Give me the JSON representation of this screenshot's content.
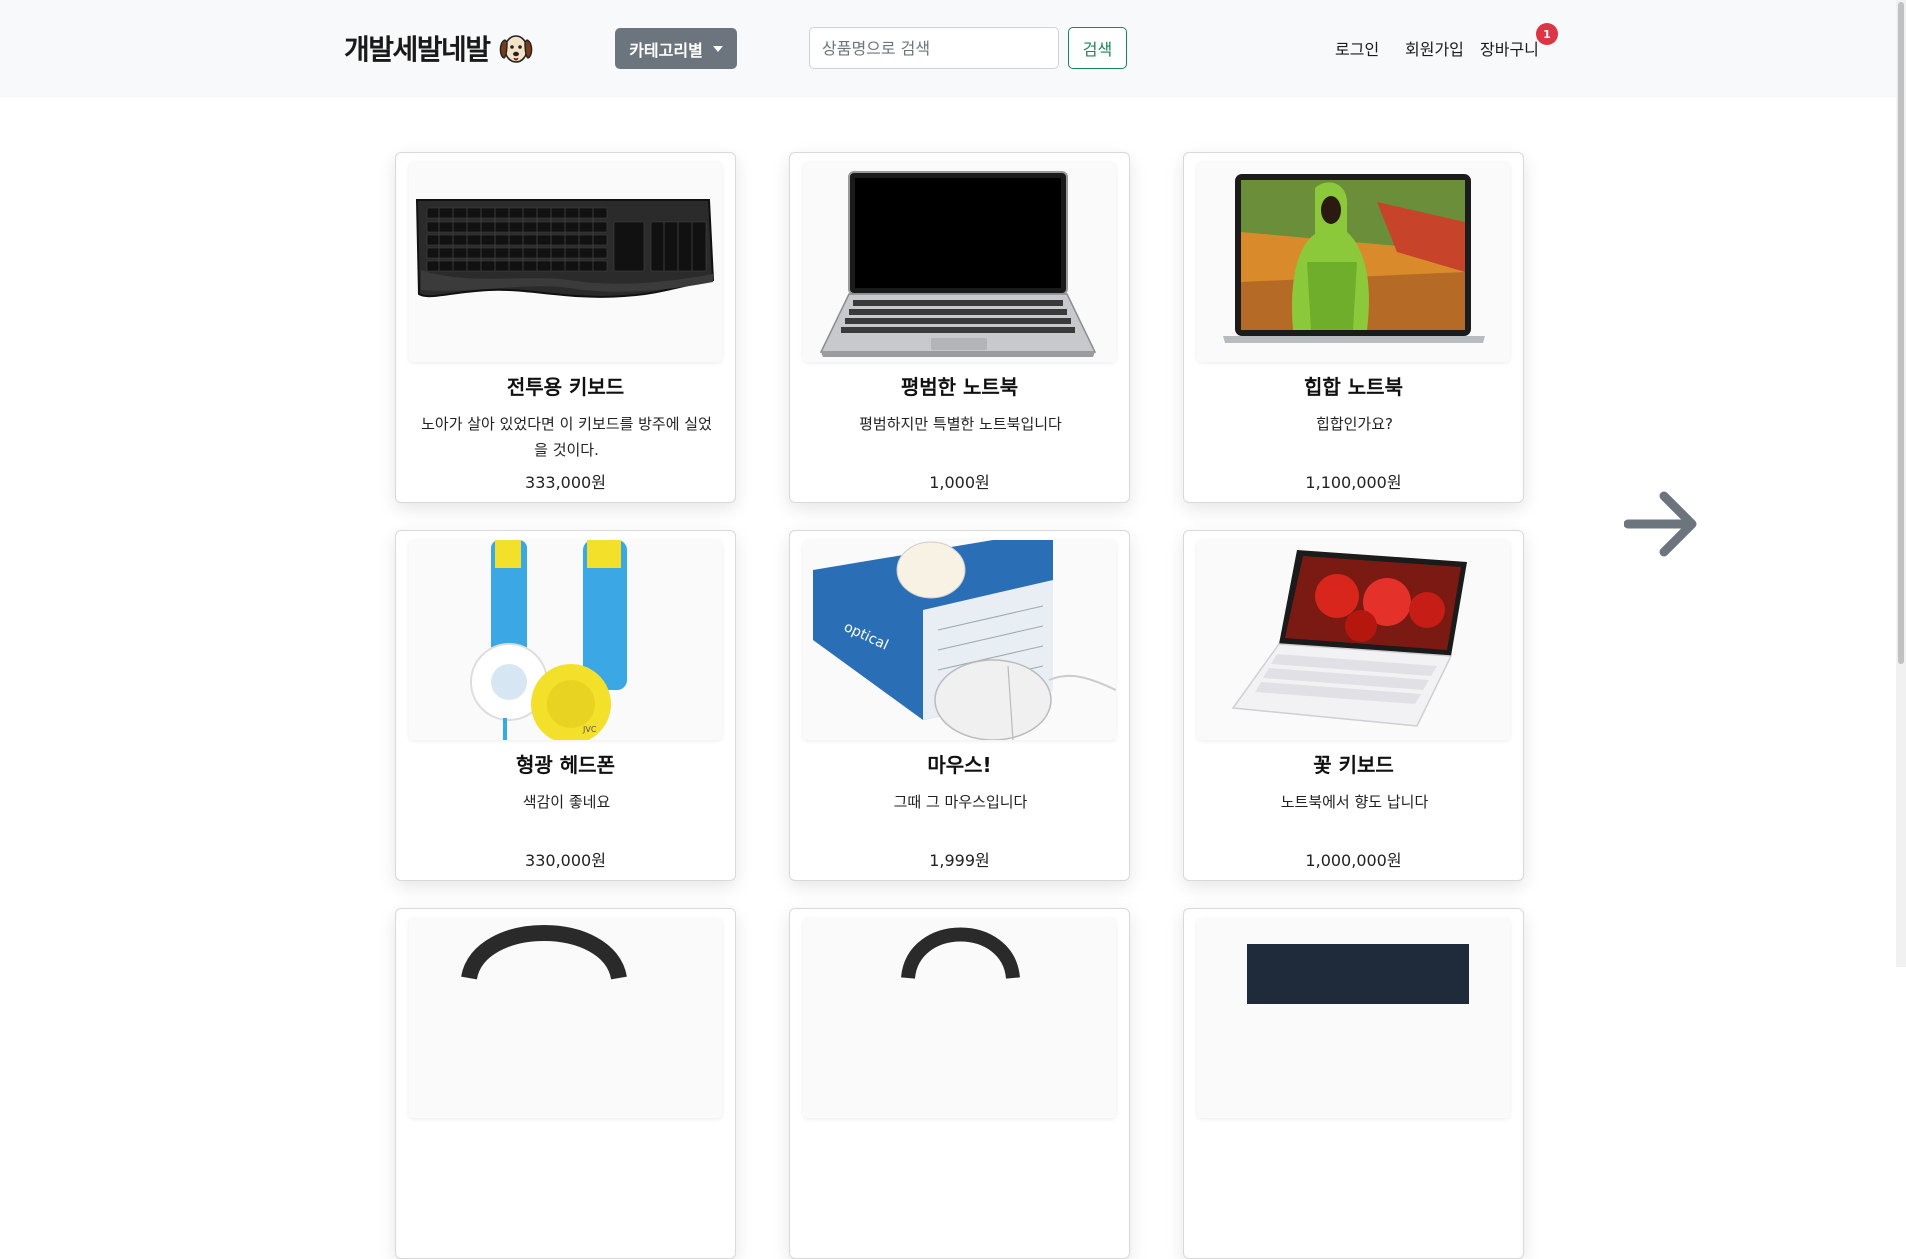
{
  "header": {
    "brand": "개발세발네발",
    "category_button": "카테고리별",
    "search_placeholder": "상품명으로 검색",
    "search_button": "검색",
    "login": "로그인",
    "signup": "회원가입",
    "cart": "장바구니",
    "cart_count": "1"
  },
  "products": [
    {
      "title": "전투용 키보드",
      "desc": "노아가 살아 있었다면 이 키보드를 방주에 실었을 것이다.",
      "price": "333,000원",
      "image": "keyboard"
    },
    {
      "title": "평범한 노트북",
      "desc": "평범하지만 특별한 노트북입니다",
      "price": "1,000원",
      "image": "laptop-silver"
    },
    {
      "title": "힙합 노트북",
      "desc": "힙합인가요?",
      "price": "1,100,000원",
      "image": "laptop-hiphop"
    },
    {
      "title": "형광 헤드폰",
      "desc": "색감이 좋네요",
      "price": "330,000원",
      "image": "headphones-neon"
    },
    {
      "title": "마우스!",
      "desc": "그때 그 마우스입니다",
      "price": "1,999원",
      "image": "mouse"
    },
    {
      "title": "꽃 키보드",
      "desc": "노트북에서 향도 납니다",
      "price": "1,000,000원",
      "image": "laptop-flower"
    }
  ],
  "next_icon": "arrow-right-icon",
  "colors": {
    "navbar_bg": "#f8f9fa",
    "category_button": "#6c757d",
    "search_button": "#198754",
    "badge": "#dc3545"
  }
}
